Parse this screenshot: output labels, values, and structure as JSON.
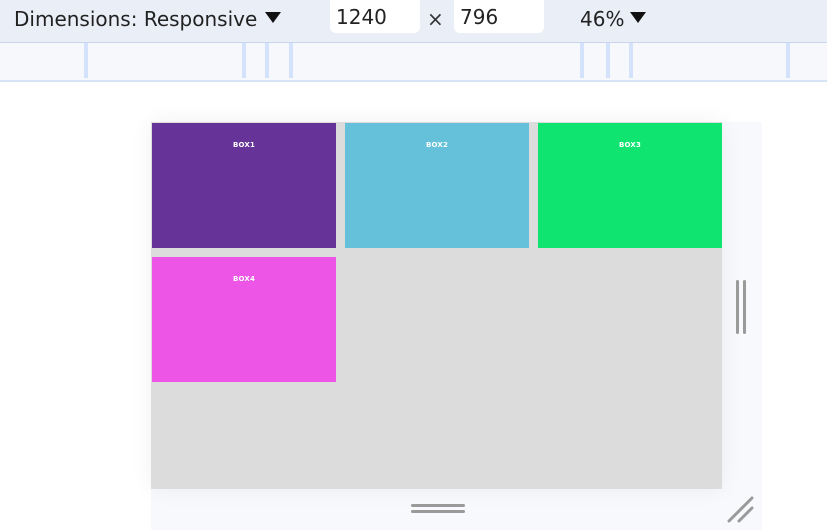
{
  "toolbar": {
    "dimensions_label": "Dimensions: Responsive",
    "width_value": "1240",
    "times": "×",
    "height_value": "796",
    "zoom_label": "46%"
  },
  "viewport": {
    "background": "#dcdcdc",
    "boxes": [
      {
        "label": "BOX1",
        "color": "#663399"
      },
      {
        "label": "BOX2",
        "color": "#65c1da"
      },
      {
        "label": "BOX3",
        "color": "#10e470"
      },
      {
        "label": "BOX4",
        "color": "#ec55e6"
      }
    ]
  },
  "icons": {
    "dropdown": "triangle-down-icon",
    "side_resize": "vertical-grip-icon",
    "bottom_resize": "horizontal-grip-icon",
    "corner_resize": "diagonal-resize-icon"
  }
}
